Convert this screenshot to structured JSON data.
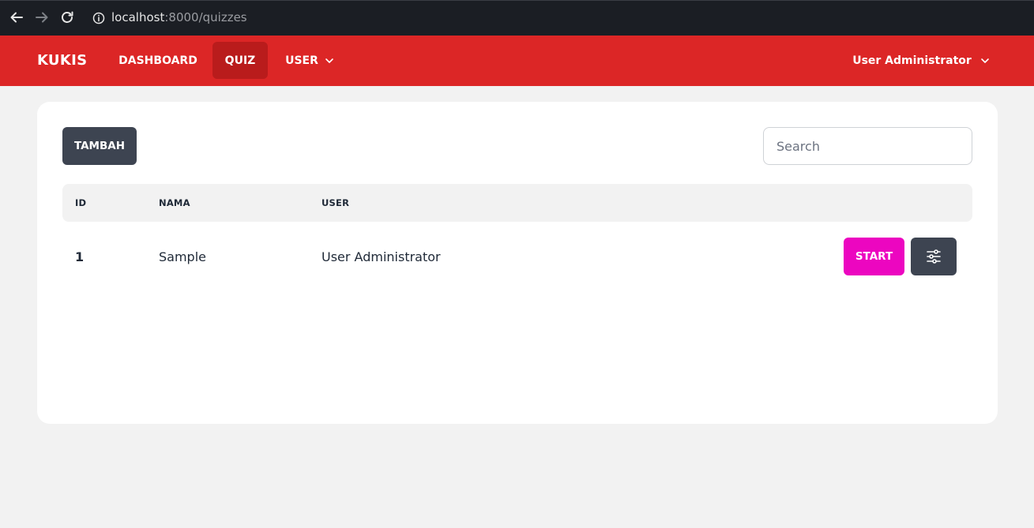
{
  "browser": {
    "url_host": "localhost",
    "url_path": ":8000/quizzes",
    "back_icon": "arrow-left-icon",
    "forward_icon": "arrow-right-icon",
    "reload_icon": "reload-icon",
    "info_icon": "info-icon"
  },
  "navbar": {
    "brand": "KUKIS",
    "links": [
      {
        "label": "DASHBOARD",
        "active": false
      },
      {
        "label": "QUIZ",
        "active": true
      },
      {
        "label": "USER",
        "active": false,
        "dropdown": true
      }
    ],
    "user_menu": "User Administrator",
    "color": "#dc2626",
    "active_color": "#b91c1c"
  },
  "toolbar": {
    "add_label": "TAMBAH",
    "search_placeholder": "Search"
  },
  "table": {
    "columns": [
      "ID",
      "NAMA",
      "USER"
    ],
    "rows": [
      {
        "id": "1",
        "nama": "Sample",
        "user": "User Administrator",
        "start_label": "START"
      }
    ]
  },
  "colors": {
    "start_button": "#ec06c0",
    "dark_button": "#3d4451"
  }
}
